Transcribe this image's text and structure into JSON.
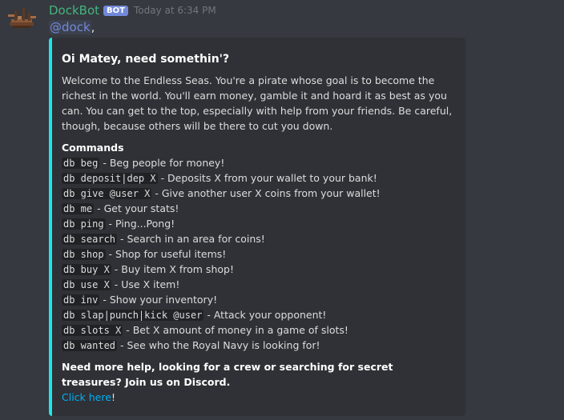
{
  "message": {
    "author": "DockBot",
    "bot_tag": "BOT",
    "timestamp": "Today at 6:34 PM",
    "mention": "@dock",
    "mention_suffix": ",",
    "avatar_icon": "ship-icon"
  },
  "embed": {
    "accent_color": "#1ce6e9",
    "title": "Oi Matey, need somethin'?",
    "description": "Welcome to the Endless Seas. You're a pirate whose goal is to become the richest in the world. You'll earn money, gamble it and hoard it as best as you can. You can get to the top, especially with help from your friends. Be careful, though, because others will be there to cut you down.",
    "commands_heading": "Commands",
    "commands": [
      {
        "code": "db beg",
        "desc": " - Beg people for money!"
      },
      {
        "code": "db deposit|dep X",
        "desc": " - Deposits X from your wallet to your bank!"
      },
      {
        "code": "db give @user X",
        "desc": " - Give another user X coins from your wallet!"
      },
      {
        "code": "db me",
        "desc": " - Get your stats!"
      },
      {
        "code": "db ping",
        "desc": " - Ping...Pong!"
      },
      {
        "code": "db search",
        "desc": " - Search in an area for coins!"
      },
      {
        "code": "db shop",
        "desc": " - Shop for useful items!"
      },
      {
        "code": "db buy X",
        "desc": " - Buy item X from shop!"
      },
      {
        "code": "db use X",
        "desc": " - Use X item!"
      },
      {
        "code": "db inv",
        "desc": " - Show your inventory!"
      },
      {
        "code": "db slap|punch|kick @user",
        "desc": " - Attack your opponent!"
      },
      {
        "code": "db slots X",
        "desc": " - Bet X amount of money in a game of slots!"
      },
      {
        "code": "db wanted",
        "desc": " - See who the Royal Navy is looking for!"
      }
    ],
    "help_text": "Need more help, looking for a crew or searching for secret treasures? Join us on Discord.",
    "link_text": "Click here",
    "link_suffix": "!"
  }
}
